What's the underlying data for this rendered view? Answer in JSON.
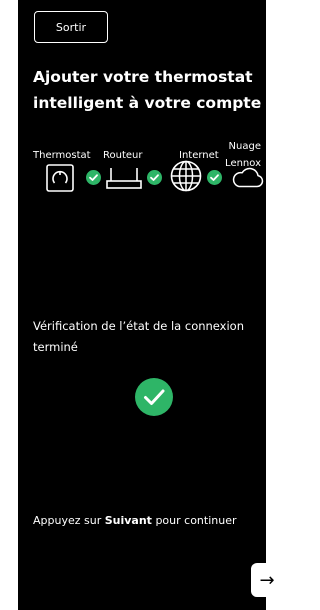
{
  "header": {
    "exit_label": "Sortir"
  },
  "main": {
    "title": "Ajouter votre thermostat intelligent à votre compte",
    "devices": [
      {
        "label": "Thermostat",
        "icon": "thermostat-icon"
      },
      {
        "label": "Routeur",
        "icon": "router-icon"
      },
      {
        "label": "Internet",
        "icon": "globe-icon"
      },
      {
        "label": "Nuage Lennox",
        "icon": "cloud-icon"
      }
    ],
    "status": "Vérification de l’état de la connexion terminé",
    "hint_prefix": "Appuyez sur ",
    "hint_bold": "Suivant",
    "hint_suffix": " pour continuer"
  },
  "colors": {
    "background": "#000000",
    "success": "#2eb567",
    "text": "#ffffff"
  },
  "icons": {
    "success": "check-circle-icon",
    "next": "arrow-right-icon"
  }
}
